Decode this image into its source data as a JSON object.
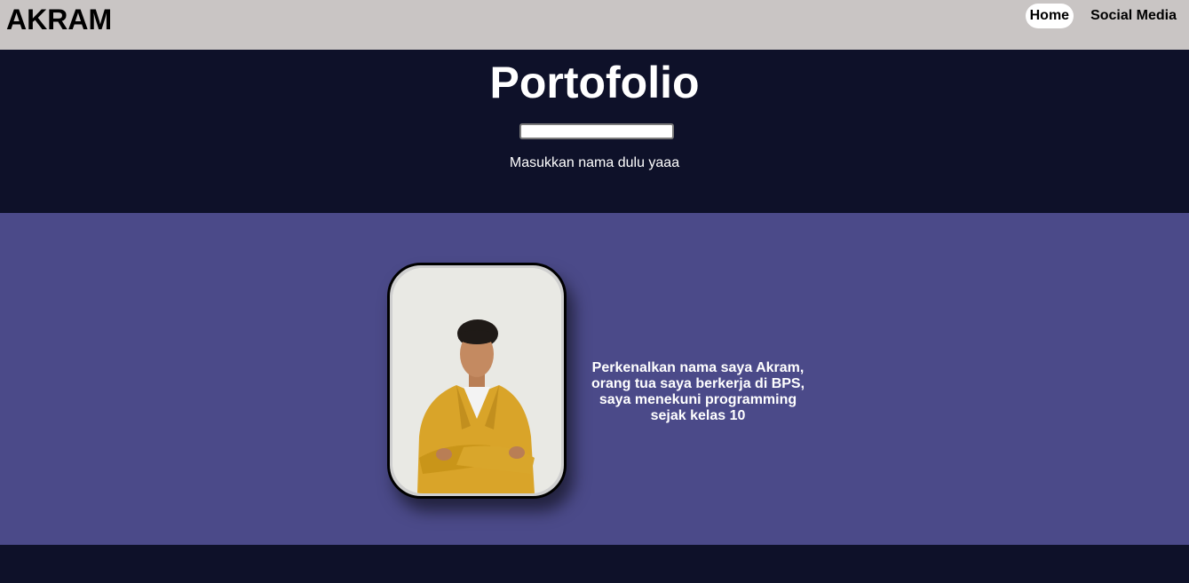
{
  "navbar": {
    "brand": "AKRAM",
    "links": [
      {
        "label": "Home",
        "active": true
      },
      {
        "label": "Social Media",
        "active": false
      }
    ]
  },
  "hero": {
    "title": "Portofolio",
    "name_input": {
      "value": "",
      "placeholder": ""
    },
    "hint": "Masukkan nama dulu yaaa"
  },
  "about": {
    "photo_icon": "profile-photo",
    "intro": "Perkenalkan nama saya Akram, orang tua saya berkerja di BPS, saya menekuni programming sejak kelas 10"
  },
  "colors": {
    "navbar_bg": "#c9c5c4",
    "hero_bg": "#0e1129",
    "about_bg": "#4b4a89",
    "jacket": "#d9a429"
  }
}
